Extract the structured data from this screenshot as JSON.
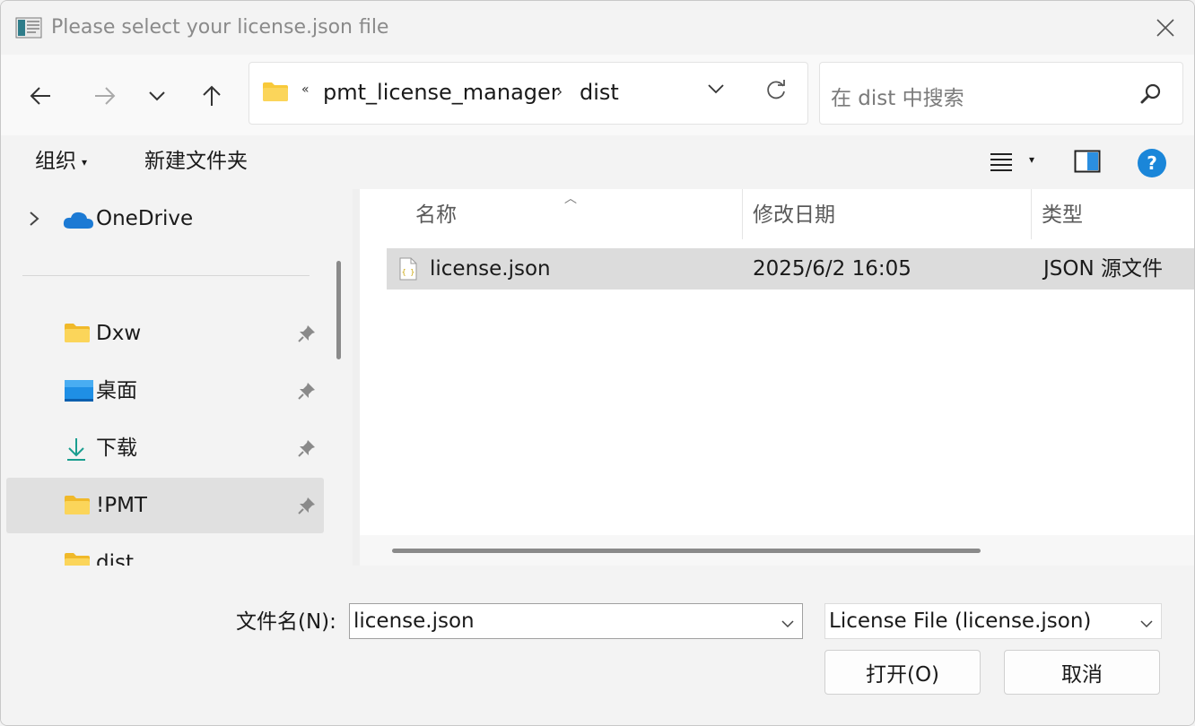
{
  "window": {
    "title": "Please select your license.json file"
  },
  "nav": {
    "back_icon": "arrow-left-icon",
    "forward_icon": "arrow-right-icon",
    "recent_icon": "chevron-down-icon",
    "up_icon": "arrow-up-icon"
  },
  "address": {
    "overflow": "«",
    "segments": [
      "pmt_license_manager",
      "dist"
    ],
    "separator": "›"
  },
  "search": {
    "placeholder": "在 dist 中搜索"
  },
  "commandbar": {
    "organize_label": "组织",
    "new_folder_label": "新建文件夹"
  },
  "sidebar": {
    "onedrive_label": "OneDrive",
    "items": [
      {
        "label": "Dxw",
        "icon": "folder-icon",
        "pinned": true
      },
      {
        "label": "桌面",
        "icon": "desktop-icon",
        "pinned": true
      },
      {
        "label": "下载",
        "icon": "download-icon",
        "pinned": true
      },
      {
        "label": "!PMT",
        "icon": "folder-icon",
        "pinned": true,
        "selected": true
      },
      {
        "label": "dist",
        "icon": "folder-icon",
        "pinned": false
      }
    ]
  },
  "filelist": {
    "columns": [
      "名称",
      "修改日期",
      "类型"
    ],
    "rows": [
      {
        "name": "license.json",
        "modified": "2025/6/2 16:05",
        "type": "JSON 源文件",
        "selected": true
      }
    ]
  },
  "footer": {
    "filename_label": "文件名(N):",
    "filename_value": "license.json",
    "filetype_value": "License File (license.json)",
    "open_label": "打开(O)",
    "cancel_label": "取消"
  },
  "colors": {
    "accent_blue": "#0078d4",
    "folder_yellow": "#f8c93a",
    "selection_gray": "#dcdcdc"
  }
}
